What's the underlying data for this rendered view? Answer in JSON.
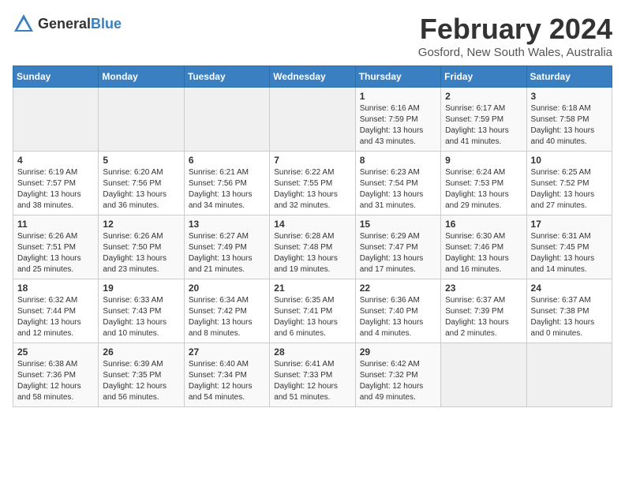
{
  "logo": {
    "general": "General",
    "blue": "Blue"
  },
  "title": "February 2024",
  "subtitle": "Gosford, New South Wales, Australia",
  "days_of_week": [
    "Sunday",
    "Monday",
    "Tuesday",
    "Wednesday",
    "Thursday",
    "Friday",
    "Saturday"
  ],
  "weeks": [
    [
      {
        "day": "",
        "info": ""
      },
      {
        "day": "",
        "info": ""
      },
      {
        "day": "",
        "info": ""
      },
      {
        "day": "",
        "info": ""
      },
      {
        "day": "1",
        "info": "Sunrise: 6:16 AM\nSunset: 7:59 PM\nDaylight: 13 hours and 43 minutes."
      },
      {
        "day": "2",
        "info": "Sunrise: 6:17 AM\nSunset: 7:59 PM\nDaylight: 13 hours and 41 minutes."
      },
      {
        "day": "3",
        "info": "Sunrise: 6:18 AM\nSunset: 7:58 PM\nDaylight: 13 hours and 40 minutes."
      }
    ],
    [
      {
        "day": "4",
        "info": "Sunrise: 6:19 AM\nSunset: 7:57 PM\nDaylight: 13 hours and 38 minutes."
      },
      {
        "day": "5",
        "info": "Sunrise: 6:20 AM\nSunset: 7:56 PM\nDaylight: 13 hours and 36 minutes."
      },
      {
        "day": "6",
        "info": "Sunrise: 6:21 AM\nSunset: 7:56 PM\nDaylight: 13 hours and 34 minutes."
      },
      {
        "day": "7",
        "info": "Sunrise: 6:22 AM\nSunset: 7:55 PM\nDaylight: 13 hours and 32 minutes."
      },
      {
        "day": "8",
        "info": "Sunrise: 6:23 AM\nSunset: 7:54 PM\nDaylight: 13 hours and 31 minutes."
      },
      {
        "day": "9",
        "info": "Sunrise: 6:24 AM\nSunset: 7:53 PM\nDaylight: 13 hours and 29 minutes."
      },
      {
        "day": "10",
        "info": "Sunrise: 6:25 AM\nSunset: 7:52 PM\nDaylight: 13 hours and 27 minutes."
      }
    ],
    [
      {
        "day": "11",
        "info": "Sunrise: 6:26 AM\nSunset: 7:51 PM\nDaylight: 13 hours and 25 minutes."
      },
      {
        "day": "12",
        "info": "Sunrise: 6:26 AM\nSunset: 7:50 PM\nDaylight: 13 hours and 23 minutes."
      },
      {
        "day": "13",
        "info": "Sunrise: 6:27 AM\nSunset: 7:49 PM\nDaylight: 13 hours and 21 minutes."
      },
      {
        "day": "14",
        "info": "Sunrise: 6:28 AM\nSunset: 7:48 PM\nDaylight: 13 hours and 19 minutes."
      },
      {
        "day": "15",
        "info": "Sunrise: 6:29 AM\nSunset: 7:47 PM\nDaylight: 13 hours and 17 minutes."
      },
      {
        "day": "16",
        "info": "Sunrise: 6:30 AM\nSunset: 7:46 PM\nDaylight: 13 hours and 16 minutes."
      },
      {
        "day": "17",
        "info": "Sunrise: 6:31 AM\nSunset: 7:45 PM\nDaylight: 13 hours and 14 minutes."
      }
    ],
    [
      {
        "day": "18",
        "info": "Sunrise: 6:32 AM\nSunset: 7:44 PM\nDaylight: 13 hours and 12 minutes."
      },
      {
        "day": "19",
        "info": "Sunrise: 6:33 AM\nSunset: 7:43 PM\nDaylight: 13 hours and 10 minutes."
      },
      {
        "day": "20",
        "info": "Sunrise: 6:34 AM\nSunset: 7:42 PM\nDaylight: 13 hours and 8 minutes."
      },
      {
        "day": "21",
        "info": "Sunrise: 6:35 AM\nSunset: 7:41 PM\nDaylight: 13 hours and 6 minutes."
      },
      {
        "day": "22",
        "info": "Sunrise: 6:36 AM\nSunset: 7:40 PM\nDaylight: 13 hours and 4 minutes."
      },
      {
        "day": "23",
        "info": "Sunrise: 6:37 AM\nSunset: 7:39 PM\nDaylight: 13 hours and 2 minutes."
      },
      {
        "day": "24",
        "info": "Sunrise: 6:37 AM\nSunset: 7:38 PM\nDaylight: 13 hours and 0 minutes."
      }
    ],
    [
      {
        "day": "25",
        "info": "Sunrise: 6:38 AM\nSunset: 7:36 PM\nDaylight: 12 hours and 58 minutes."
      },
      {
        "day": "26",
        "info": "Sunrise: 6:39 AM\nSunset: 7:35 PM\nDaylight: 12 hours and 56 minutes."
      },
      {
        "day": "27",
        "info": "Sunrise: 6:40 AM\nSunset: 7:34 PM\nDaylight: 12 hours and 54 minutes."
      },
      {
        "day": "28",
        "info": "Sunrise: 6:41 AM\nSunset: 7:33 PM\nDaylight: 12 hours and 51 minutes."
      },
      {
        "day": "29",
        "info": "Sunrise: 6:42 AM\nSunset: 7:32 PM\nDaylight: 12 hours and 49 minutes."
      },
      {
        "day": "",
        "info": ""
      },
      {
        "day": "",
        "info": ""
      }
    ]
  ]
}
